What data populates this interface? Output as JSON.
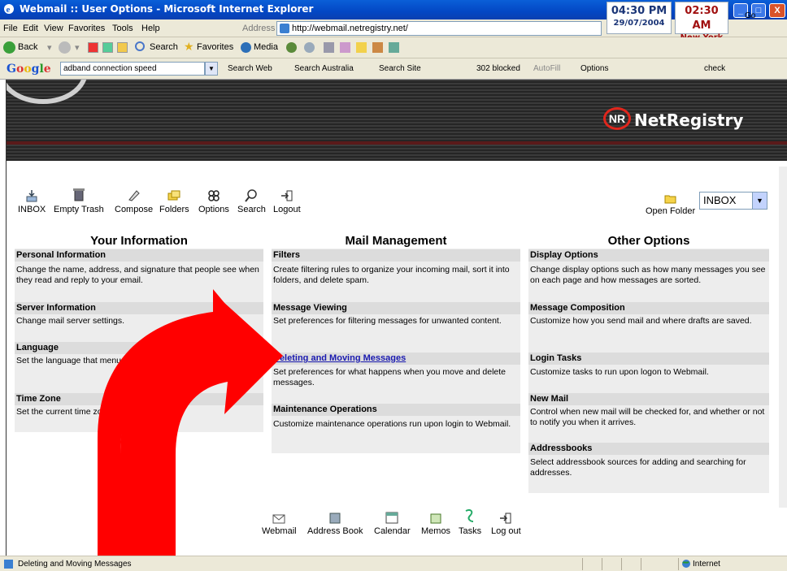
{
  "window": {
    "title": "Webmail :: User Options - Microsoft Internet Explorer",
    "clock_local_time": "04:30 PM",
    "clock_local_date": "29/07/2004",
    "clock_ny_time": "02:30 AM",
    "clock_ny_city": "New York"
  },
  "menu": {
    "items": [
      "File",
      "Edit",
      "View",
      "Favorites",
      "Tools",
      "Help"
    ],
    "address_label": "Address",
    "url": "http://webmail.netregistry.net/",
    "go": "Go"
  },
  "nav": {
    "back": "Back",
    "search": "Search",
    "favorites": "Favorites",
    "media": "Media"
  },
  "googlebar": {
    "logo": "Google",
    "query": "adband connection speed",
    "search_web": "Search Web",
    "search_australia": "Search Australia",
    "search_site": "Search Site",
    "blocked": "302 blocked",
    "autofill": "AutoFill",
    "options": "Options",
    "check": "check"
  },
  "banner": {
    "brand_mark": "NR",
    "brand": "NetRegistry"
  },
  "toolbar": {
    "items": [
      "INBOX",
      "Empty Trash",
      "Compose",
      "Folders",
      "Options",
      "Search",
      "Logout"
    ],
    "open_folder": "Open Folder",
    "folder_select": "INBOX"
  },
  "columns": {
    "your_information": {
      "title": "Your Information",
      "sections": [
        {
          "heading": "Personal Information",
          "body": "Change the name, address, and signature that people see when they read and reply to your email."
        },
        {
          "heading": "Server Information",
          "body": "Change mail server settings."
        },
        {
          "heading": "Language",
          "body": "Set the language that menus, buttons, and messages are in."
        },
        {
          "heading": "Time Zone",
          "body": "Set the current time zone."
        }
      ]
    },
    "mail_management": {
      "title": "Mail Management",
      "sections": [
        {
          "heading": "Filters",
          "body": "Create filtering rules to organize your incoming mail, sort it into folders, and delete spam."
        },
        {
          "heading": "Message Viewing",
          "body": "Set preferences for filtering messages for unwanted content."
        },
        {
          "heading": "Deleting and Moving Messages",
          "body": "Set preferences for what happens when you move and delete messages."
        },
        {
          "heading": "Maintenance Operations",
          "body": "Customize maintenance operations run upon login to Webmail."
        }
      ]
    },
    "other_options": {
      "title": "Other Options",
      "sections": [
        {
          "heading": "Display Options",
          "body": "Change display options such as how many messages you see on each page and how messages are sorted."
        },
        {
          "heading": "Message Composition",
          "body": "Customize how you send mail and where drafts are saved."
        },
        {
          "heading": "Login Tasks",
          "body": "Customize tasks to run upon logon to Webmail."
        },
        {
          "heading": "New Mail",
          "body": "Control when new mail will be checked for, and whether or not to notify you when it arrives."
        },
        {
          "heading": "Addressbooks",
          "body": "Select addressbook sources for adding and searching for addresses."
        }
      ]
    }
  },
  "footer": {
    "items": [
      "Webmail",
      "Address Book",
      "Calendar",
      "Memos",
      "Tasks",
      "Log out"
    ]
  },
  "status": {
    "text": "Deleting and Moving Messages",
    "zone": "Internet"
  },
  "colors": {
    "arrow": "#ff0000",
    "link": "#1a1ab0",
    "section_header": "#dcdcdc",
    "panel": "#ededed"
  }
}
